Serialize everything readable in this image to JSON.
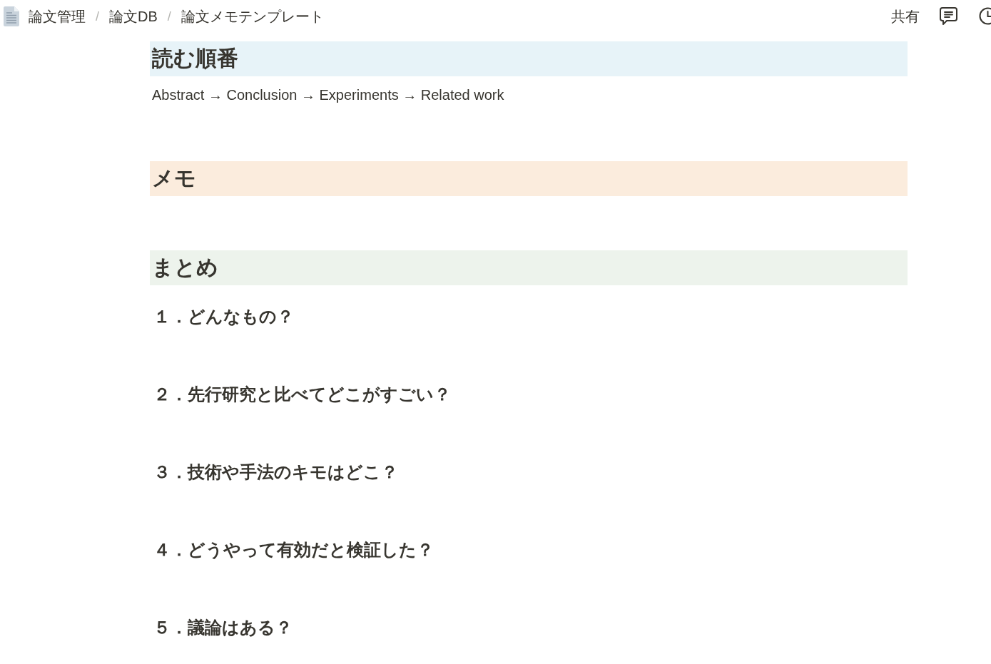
{
  "breadcrumb": [
    {
      "kind": "page",
      "label": "論文管理"
    },
    {
      "kind": "separator",
      "label": "/"
    },
    {
      "kind": "page",
      "label": "論文DB"
    },
    {
      "kind": "separator",
      "label": "/"
    },
    {
      "kind": "page",
      "label": "論文メモテンプレート"
    }
  ],
  "topbar": {
    "share": "共有"
  },
  "blocks": [
    {
      "kind": "heading",
      "text": "読む順番",
      "color": "#e7f3f8"
    },
    {
      "kind": "paragraph",
      "text": "Abstract → Conclusion → Experiments → Related work"
    },
    {
      "kind": "heading",
      "text": "メモ",
      "color": "#fbecdd"
    },
    {
      "kind": "heading",
      "text": "まとめ",
      "color": "#edf3ec"
    },
    {
      "kind": "question",
      "text": "１．どんなもの？"
    },
    {
      "kind": "question",
      "text": "２．先行研究と比べてどこがすごい？"
    },
    {
      "kind": "question",
      "text": "３．技術や手法のキモはどこ？"
    },
    {
      "kind": "question",
      "text": "４．どうやって有効だと検証した？"
    },
    {
      "kind": "question",
      "text": "５．議論はある？"
    }
  ]
}
